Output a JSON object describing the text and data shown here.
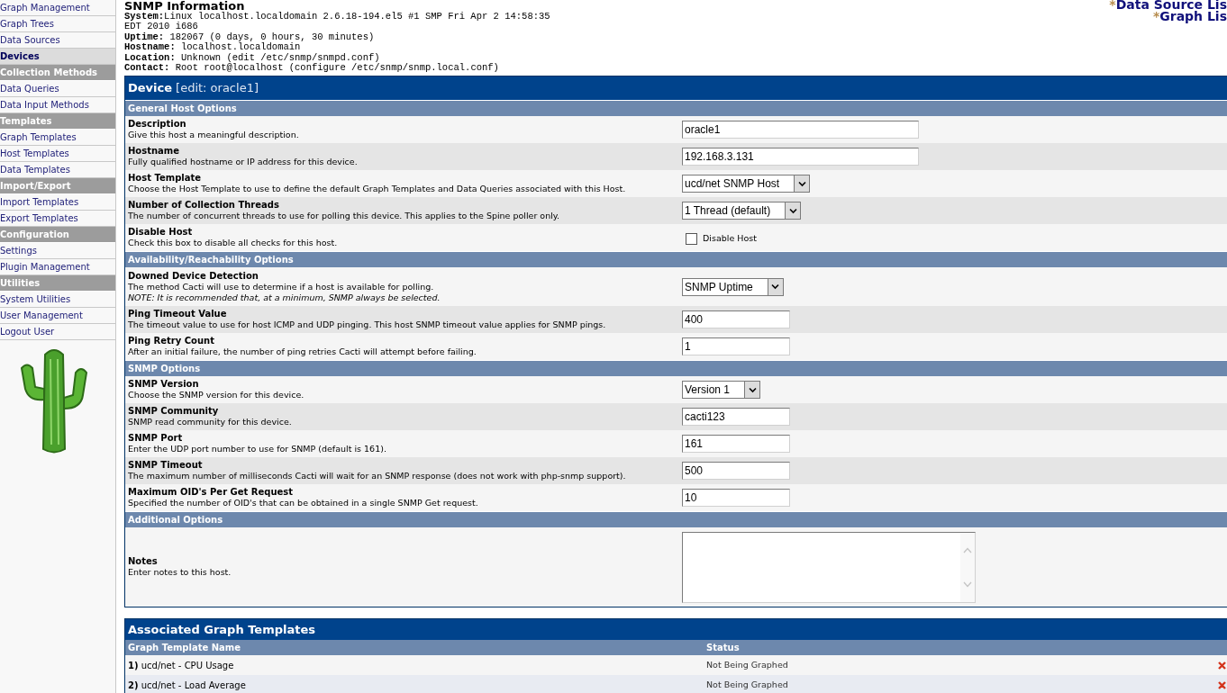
{
  "sidebar": {
    "items": [
      {
        "kind": "link",
        "label": "Graph Management",
        "selected": false
      },
      {
        "kind": "link",
        "label": "Graph Trees",
        "selected": false
      },
      {
        "kind": "link",
        "label": "Data Sources",
        "selected": false
      },
      {
        "kind": "link",
        "label": "Devices",
        "selected": true
      },
      {
        "kind": "header",
        "label": "Collection Methods"
      },
      {
        "kind": "link",
        "label": "Data Queries",
        "selected": false
      },
      {
        "kind": "link",
        "label": "Data Input Methods",
        "selected": false
      },
      {
        "kind": "header",
        "label": "Templates"
      },
      {
        "kind": "link",
        "label": "Graph Templates",
        "selected": false
      },
      {
        "kind": "link",
        "label": "Host Templates",
        "selected": false
      },
      {
        "kind": "link",
        "label": "Data Templates",
        "selected": false
      },
      {
        "kind": "header",
        "label": "Import/Export"
      },
      {
        "kind": "link",
        "label": "Import Templates",
        "selected": false
      },
      {
        "kind": "link",
        "label": "Export Templates",
        "selected": false
      },
      {
        "kind": "header",
        "label": "Configuration"
      },
      {
        "kind": "link",
        "label": "Settings",
        "selected": false
      },
      {
        "kind": "link",
        "label": "Plugin Management",
        "selected": false
      },
      {
        "kind": "header",
        "label": "Utilities"
      },
      {
        "kind": "link",
        "label": "System Utilities",
        "selected": false
      },
      {
        "kind": "link",
        "label": "User Management",
        "selected": false
      },
      {
        "kind": "link",
        "label": "Logout User",
        "selected": false
      }
    ]
  },
  "snmp_info": {
    "title": "SNMP Information",
    "lines": [
      "**System:**Linux localhost.localdomain 2.6.18-194.el5 #1 SMP Fri Apr 2 14:58:35",
      "EDT 2010 i686",
      "**Uptime:** 182067 (0 days, 0 hours, 30 minutes)",
      "**Hostname:** localhost.localdomain",
      "**Location:** Unknown (edit /etc/snmp/snmpd.conf)",
      "**Contact:** Root root@localhost (configure /etc/snmp/snmp.local.conf)"
    ]
  },
  "header_links": [
    {
      "mark": "*",
      "label": "Data Source Lis"
    },
    {
      "mark": "*",
      "label": "Graph Lis"
    }
  ],
  "device_form": {
    "title": "Device",
    "subtitle": "[edit: oracle1]",
    "sections": [
      {
        "title": "General Host Options",
        "fields": [
          {
            "label": "Description",
            "description": "Give this host a meaningful description.",
            "control": {
              "kind": "text",
              "wide": true,
              "value": "oracle1"
            }
          },
          {
            "label": "Hostname",
            "description": "Fully qualified hostname or IP address for this device.",
            "control": {
              "kind": "text",
              "wide": true,
              "value": "192.168.3.131"
            }
          },
          {
            "label": "Host Template",
            "description": "Choose the Host Template to use to define the default Graph Templates and Data Queries associated with this Host.",
            "control": {
              "kind": "select",
              "value": "ucd/net SNMP Host"
            }
          },
          {
            "label": "Number of Collection Threads",
            "description": "The number of concurrent threads to use for polling this device. This applies to the Spine poller only.",
            "control": {
              "kind": "select",
              "value": "1 Thread (default)"
            }
          },
          {
            "label": "Disable Host",
            "description": "Check this box to disable all checks for this host.",
            "control": {
              "kind": "checkbox",
              "label": "Disable Host",
              "checked": false
            }
          }
        ]
      },
      {
        "title": "Availability/Reachability Options",
        "fields": [
          {
            "label": "Downed Device Detection",
            "description": "The method Cacti will use to determine if a host is available for polling.",
            "note": "NOTE: It is recommended that, at a minimum, SNMP always be selected.",
            "control": {
              "kind": "select",
              "value": "SNMP Uptime"
            }
          },
          {
            "label": "Ping Timeout Value",
            "description": "The timeout value to use for host ICMP and UDP pinging. This host SNMP timeout value applies for SNMP pings.",
            "control": {
              "kind": "text",
              "wide": false,
              "value": "400"
            }
          },
          {
            "label": "Ping Retry Count",
            "description": "After an initial failure, the number of ping retries Cacti will attempt before failing.",
            "control": {
              "kind": "text",
              "wide": false,
              "value": "1"
            }
          }
        ]
      },
      {
        "title": "SNMP Options",
        "fields": [
          {
            "label": "SNMP Version",
            "description": "Choose the SNMP version for this device.",
            "control": {
              "kind": "select",
              "value": "Version 1"
            }
          },
          {
            "label": "SNMP Community",
            "description": "SNMP read community for this device.",
            "control": {
              "kind": "text",
              "wide": false,
              "value": "cacti123"
            }
          },
          {
            "label": "SNMP Port",
            "description": "Enter the UDP port number to use for SNMP (default is 161).",
            "control": {
              "kind": "text",
              "wide": false,
              "value": "161"
            }
          },
          {
            "label": "SNMP Timeout",
            "description": "The maximum number of milliseconds Cacti will wait for an SNMP response (does not work with php-snmp support).",
            "control": {
              "kind": "text",
              "wide": false,
              "value": "500"
            }
          },
          {
            "label": "Maximum OID's Per Get Request",
            "description": "Specified the number of OID's that can be obtained in a single SNMP Get request.",
            "control": {
              "kind": "text",
              "wide": false,
              "value": "10"
            }
          }
        ]
      },
      {
        "title": "Additional Options",
        "fields": [
          {
            "label": "Notes",
            "description": "Enter notes to this host.",
            "control": {
              "kind": "textarea"
            }
          }
        ]
      }
    ]
  },
  "graph_templates": {
    "title": "Associated Graph Templates",
    "columns": [
      "Graph Template Name",
      "Status"
    ],
    "rows": [
      {
        "number": "1)",
        "name": "ucd/net - CPU Usage",
        "status": "Not Being Graphed"
      },
      {
        "number": "2)",
        "name": "ucd/net - Load Average",
        "status": "Not Being Graphed"
      }
    ]
  }
}
